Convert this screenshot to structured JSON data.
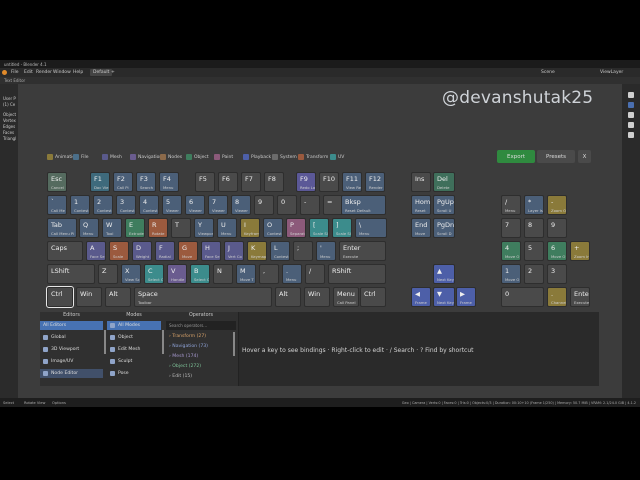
{
  "window": {
    "title": "untitled - Blender 4.1",
    "menus": [
      "File",
      "Edit",
      "Render",
      "Window",
      "Help"
    ],
    "workspace_tab": "Default",
    "add_tab": "+",
    "scene_label": "Scene",
    "view_layer_label": "ViewLayer",
    "editor_header": "Text Editor"
  },
  "left_col_lines": [
    "User P",
    "(1) Ce",
    "Object",
    "Vertex",
    "Edges",
    "Faces",
    "Triangl"
  ],
  "watermark": "@devanshutak25",
  "legend": [
    {
      "label": "Animation",
      "color": "#8a7a3a"
    },
    {
      "label": "File",
      "color": "#4b6f8a"
    },
    {
      "label": "Mesh",
      "color": "#5a5a8c"
    },
    {
      "label": "Navigation",
      "color": "#6a5c8f"
    },
    {
      "label": "Nodes",
      "color": "#8c6a4a"
    },
    {
      "label": "Object",
      "color": "#3f7d5e"
    },
    {
      "label": "Paint",
      "color": "#8c5a7a"
    },
    {
      "label": "Playback",
      "color": "#4d5fa8"
    },
    {
      "label": "System",
      "color": "#6b6b6b"
    },
    {
      "label": "Transform",
      "color": "#9b5a3e"
    },
    {
      "label": "UV",
      "color": "#3c8c8c"
    }
  ],
  "buttons": {
    "export": "Export",
    "presets": "Presets",
    "close": "X"
  },
  "keys": [
    {
      "l": "Esc",
      "s": "Cancel",
      "c": "#556b5f"
    },
    {
      "l": "F1",
      "s": "Doc Vie",
      "c": "#3e6a7c"
    },
    {
      "l": "F2",
      "s": "Call Pi",
      "c": "#4b5f78"
    },
    {
      "l": "F3",
      "s": "Search",
      "c": "#4b5f78"
    },
    {
      "l": "F4",
      "s": "Menu",
      "c": "#4b5f78"
    },
    {
      "l": "F5",
      "s": "",
      "c": "#4a4a4a"
    },
    {
      "l": "F6",
      "s": "",
      "c": "#4a4a4a"
    },
    {
      "l": "F7",
      "s": "",
      "c": "#4a4a4a"
    },
    {
      "l": "F8",
      "s": "",
      "c": "#4a4a4a"
    },
    {
      "l": "F9",
      "s": "Redo La",
      "c": "#5b5897"
    },
    {
      "l": "F10",
      "s": "",
      "c": "#4a4a4a"
    },
    {
      "l": "F11",
      "s": "View Re",
      "c": "#4b5f78"
    },
    {
      "l": "F12",
      "s": "Render",
      "c": "#4b5f78"
    },
    {
      "l": "Ins",
      "s": "",
      "c": "#4a4a4a"
    },
    {
      "l": "Del",
      "s": "Delete",
      "c": "#3f6f5b"
    },
    {
      "l": "`",
      "s": "Call Me",
      "c": "#4b5f78"
    },
    {
      "l": "1",
      "s": "Contest",
      "c": "#4b5f78"
    },
    {
      "l": "2",
      "s": "Contest",
      "c": "#4b5f78"
    },
    {
      "l": "3",
      "s": "Contest",
      "c": "#4b5f78"
    },
    {
      "l": "4",
      "s": "Contest",
      "c": "#4b5f78"
    },
    {
      "l": "5",
      "s": "Viewer",
      "c": "#4b5f78"
    },
    {
      "l": "6",
      "s": "Viewer",
      "c": "#4b5f78"
    },
    {
      "l": "7",
      "s": "Viewer",
      "c": "#4b5f78"
    },
    {
      "l": "8",
      "s": "Viewer",
      "c": "#4b5f78"
    },
    {
      "l": "9",
      "s": "",
      "c": "#4a4a4a"
    },
    {
      "l": "0",
      "s": "",
      "c": "#4a4a4a"
    },
    {
      "l": "-",
      "s": "",
      "c": "#4a4a4a"
    },
    {
      "l": "=",
      "s": "",
      "c": "#4a4a4a"
    },
    {
      "l": "Bksp",
      "s": "Reset Default",
      "c": "#4b5f78"
    },
    {
      "l": "Home",
      "s": "Reset",
      "c": "#4b5f78"
    },
    {
      "l": "PgUp",
      "s": "Scroll U",
      "c": "#4b5f78"
    },
    {
      "l": "/",
      "s": "Menu",
      "c": "#4a4a4a"
    },
    {
      "l": "*",
      "s": "Layer Is",
      "c": "#4b5f78"
    },
    {
      "l": "-",
      "s": "Zoom O",
      "c": "#8a7a3a"
    },
    {
      "l": "Tab",
      "s": "Call Menu Pi",
      "c": "#4b5f78"
    },
    {
      "l": "Q",
      "s": "Menu",
      "c": "#4b5f78"
    },
    {
      "l": "W",
      "s": "Tool",
      "c": "#4b5f78"
    },
    {
      "l": "E",
      "s": "Extrude",
      "c": "#3f7d5e"
    },
    {
      "l": "R",
      "s": "Rotate",
      "c": "#9b5a3e"
    },
    {
      "l": "T",
      "s": "",
      "c": "#4a4a4a"
    },
    {
      "l": "Y",
      "s": "Viewpor",
      "c": "#4b5f78"
    },
    {
      "l": "U",
      "s": "Menu",
      "c": "#4b5f78"
    },
    {
      "l": "I",
      "s": "Keyfram",
      "c": "#8a7a3a"
    },
    {
      "l": "O",
      "s": "Contest",
      "c": "#4b5f78"
    },
    {
      "l": "P",
      "s": "Separate",
      "c": "#8c5a7a"
    },
    {
      "l": "[",
      "s": "Scale Sl",
      "c": "#3c8c8c"
    },
    {
      "l": "]",
      "s": "Scale Sl",
      "c": "#3c8c8c"
    },
    {
      "l": "\\",
      "s": "Menu",
      "c": "#4b5f78"
    },
    {
      "l": "End",
      "s": "Move",
      "c": "#4b5f78"
    },
    {
      "l": "PgDn",
      "s": "Scroll D",
      "c": "#4b5f78"
    },
    {
      "l": "7",
      "s": "",
      "c": "#4a4a4a"
    },
    {
      "l": "8",
      "s": "",
      "c": "#4a4a4a"
    },
    {
      "l": "9",
      "s": "",
      "c": "#4a4a4a"
    },
    {
      "l": "Caps",
      "s": "",
      "c": "#4a4a4a"
    },
    {
      "l": "A",
      "s": "Face Se",
      "c": "#5a5a8c"
    },
    {
      "l": "S",
      "s": "Scale",
      "c": "#9b5a3e"
    },
    {
      "l": "D",
      "s": "Weight",
      "c": "#5a5a8c"
    },
    {
      "l": "F",
      "s": "Radial",
      "c": "#5a5a8c"
    },
    {
      "l": "G",
      "s": "Move",
      "c": "#9b5a3e"
    },
    {
      "l": "H",
      "s": "Face Se",
      "c": "#5a5a8c"
    },
    {
      "l": "J",
      "s": "Vert Co",
      "c": "#5a5a8c"
    },
    {
      "l": "K",
      "s": "Keymap",
      "c": "#8a7a3a"
    },
    {
      "l": "L",
      "s": "Contest",
      "c": "#4b5f78"
    },
    {
      "l": ";",
      "s": "",
      "c": "#4a4a4a"
    },
    {
      "l": "'",
      "s": "Menu",
      "c": "#4b5f78"
    },
    {
      "l": "Enter",
      "s": "Execute",
      "c": "#4a4a4a"
    },
    {
      "l": "4",
      "s": "Move O",
      "c": "#3f7d5e"
    },
    {
      "l": "5",
      "s": "",
      "c": "#4a4a4a"
    },
    {
      "l": "6",
      "s": "Move O",
      "c": "#3f7d5e"
    },
    {
      "l": "+",
      "s": "Zoom In",
      "c": "#8a7a3a"
    },
    {
      "l": "LShift",
      "s": "",
      "c": "#4a4a4a"
    },
    {
      "l": "Z",
      "s": "",
      "c": "#4a4a4a"
    },
    {
      "l": "X",
      "s": "View Sc",
      "c": "#4b5f78"
    },
    {
      "l": "C",
      "s": "Select C",
      "c": "#3c8c8c"
    },
    {
      "l": "V",
      "s": "Handle",
      "c": "#6a5c8f"
    },
    {
      "l": "B",
      "s": "Select C",
      "c": "#3c8c8c"
    },
    {
      "l": "N",
      "s": "",
      "c": "#4a4a4a"
    },
    {
      "l": "M",
      "s": "Move T",
      "c": "#4b5f78"
    },
    {
      "l": ",",
      "s": "",
      "c": "#4a4a4a"
    },
    {
      "l": ".",
      "s": "Menu",
      "c": "#4b5f78"
    },
    {
      "l": "/",
      "s": "",
      "c": "#4a4a4a"
    },
    {
      "l": "RShift",
      "s": "",
      "c": "#4a4a4a"
    },
    {
      "l": "▲",
      "s": "Next Key",
      "c": "#4d5fa8"
    },
    {
      "l": "1",
      "s": "Move O",
      "c": "#4b5f78"
    },
    {
      "l": "2",
      "s": "",
      "c": "#4a4a4a"
    },
    {
      "l": "3",
      "s": "",
      "c": "#4a4a4a"
    },
    {
      "l": "Ctrl",
      "s": "",
      "c": "#4a4a4a"
    },
    {
      "l": "Win",
      "s": "",
      "c": "#4a4a4a"
    },
    {
      "l": "Alt",
      "s": "",
      "c": "#4a4a4a"
    },
    {
      "l": "Space",
      "s": "Toolbar",
      "c": "#4a4a4a"
    },
    {
      "l": "Alt",
      "s": "",
      "c": "#4a4a4a"
    },
    {
      "l": "Win",
      "s": "",
      "c": "#4a4a4a"
    },
    {
      "l": "Menu",
      "s": "Call Panel",
      "c": "#4a4a4a"
    },
    {
      "l": "Ctrl",
      "s": "",
      "c": "#4a4a4a"
    },
    {
      "l": "◀",
      "s": "Frame",
      "c": "#4d5fa8"
    },
    {
      "l": "▼",
      "s": "Next Key",
      "c": "#4d5fa8"
    },
    {
      "l": "▶",
      "s": "Frame",
      "c": "#4d5fa8"
    },
    {
      "l": "0",
      "s": "",
      "c": "#4a4a4a"
    },
    {
      "l": ".",
      "s": "Channel",
      "c": "#8a7a3a"
    },
    {
      "l": "Enter",
      "s": "Execute",
      "c": "#4a4a4a"
    }
  ],
  "editors": {
    "header": "Editors",
    "items": [
      "All Editors",
      "Global",
      "3D Viewport",
      "Image/UV",
      "Node Editor"
    ]
  },
  "modes": {
    "header": "Modes",
    "items": [
      "All Modes",
      "Object",
      "Edit Mesh",
      "Sculpt",
      "Pose"
    ]
  },
  "operators": {
    "header": "Operators",
    "search_placeholder": "Search operators...",
    "items": [
      "› Transform (27)",
      "› Navigation (73)",
      "› Mesh (174)",
      "› Object (272)",
      "› Edit (15)"
    ]
  },
  "help_text": "Hover a key to see bindings  ·  Right-click to edit  ·  / Search  ·  ? Find by shortcut",
  "status": {
    "left": [
      "Select",
      "Rotate View",
      "Options"
    ],
    "right": "Geo | Camera | Verts:0 | Faces:0 | Tris:0 | Objects:0/3 | Duration: 00:10+10 (Frame 1/250) | Memory: 50.7 MiB | VRAM: 2.1/24.0 GiB | 4.1.2"
  }
}
